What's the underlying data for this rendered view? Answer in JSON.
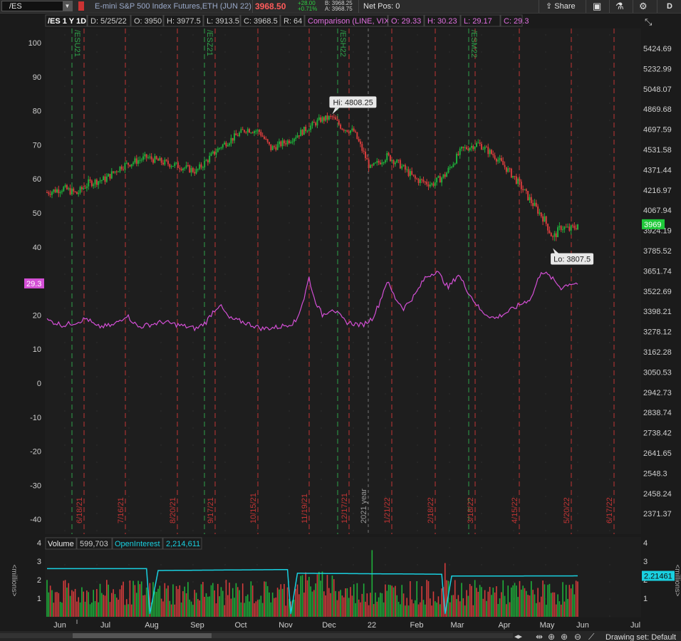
{
  "toolbar": {
    "symbol": "/ES",
    "description": "E-mini S&P 500 Index Futures,ETH (JUN 22)",
    "last": "3968.50",
    "change": "+28.00",
    "change_pct": "+0.71%",
    "bid": "B: 3968.25",
    "ask": "A: 3968.75",
    "net_pos": "Net Pos: 0",
    "share_label": "Share",
    "d_label": "D"
  },
  "header": {
    "title": "/ES 1 Y 1D",
    "date": "D: 5/25/22",
    "open": "O: 3950",
    "high": "H: 3977.5",
    "low": "L: 3913.5",
    "close": "C: 3968.5",
    "range": "R: 64",
    "comparison": "Comparison (LINE, VIX)",
    "c_open": "O: 29.33",
    "c_high": "H: 30.23",
    "c_low": "L: 29.17",
    "c_close": "C: 29.3"
  },
  "colors": {
    "up": "#1fae3a",
    "down": "#d43c3c",
    "vix": "#d44fd6",
    "oi": "#19d0e0",
    "exp_line": "#2fa34a",
    "month_line": "#c23434"
  },
  "chart_data": [
    {
      "type": "candlestick",
      "title": "/ES 1 Y 1D",
      "price_axis": [
        "5424.69",
        "5232.99",
        "5048.07",
        "4869.68",
        "4697.59",
        "4531.58",
        "4371.44",
        "4216.97",
        "4067.94",
        "3924.19",
        "3785.52",
        "3651.74",
        "3522.69",
        "3398.21",
        "3278.12",
        "3162.28",
        "3050.53",
        "2942.73",
        "2838.74",
        "2738.42",
        "2641.65",
        "2548.3",
        "2458.24",
        "2371.37"
      ],
      "left_axis": [
        100,
        90,
        80,
        70,
        60,
        50,
        40,
        30,
        20,
        10,
        0,
        -10,
        -20,
        -30,
        -40
      ],
      "ylim": [
        2290,
        5640
      ],
      "last_price_label": "3969",
      "high_label": "Hi: 4808.25",
      "low_label": "Lo: 3807.5",
      "high_value": 4808.25,
      "low_value": 3807.5,
      "month_labels": [
        "Jun",
        "Jul",
        "Aug",
        "Sep",
        "Oct",
        "Nov",
        "Dec",
        "22",
        "Feb",
        "Mar",
        "Apr",
        "May",
        "Jun",
        "Jul"
      ],
      "expiration_labels": [
        "/ESU21",
        "/ESZ21",
        "/ESH22",
        "/ESM22"
      ],
      "date_labels": [
        "6/18/21",
        "7/16/21",
        "8/20/21",
        "9/17/21",
        "10/15/21",
        "11/19/21",
        "12/17/21",
        "2021 year",
        "1/21/22",
        "2/18/22",
        "3/18/22",
        "4/15/22",
        "5/20/22",
        "6/17/22"
      ],
      "price_keypoints": [
        [
          0,
          4200
        ],
        [
          10,
          4230
        ],
        [
          18,
          4190
        ],
        [
          25,
          4270
        ],
        [
          35,
          4300
        ],
        [
          45,
          4400
        ],
        [
          60,
          4470
        ],
        [
          70,
          4430
        ],
        [
          80,
          4400
        ],
        [
          90,
          4360
        ],
        [
          105,
          4560
        ],
        [
          120,
          4700
        ],
        [
          128,
          4680
        ],
        [
          135,
          4540
        ],
        [
          145,
          4600
        ],
        [
          155,
          4690
        ],
        [
          165,
          4780
        ],
        [
          172,
          4800
        ],
        [
          178,
          4710
        ],
        [
          185,
          4680
        ],
        [
          195,
          4380
        ],
        [
          205,
          4480
        ],
        [
          212,
          4420
        ],
        [
          222,
          4300
        ],
        [
          232,
          4260
        ],
        [
          240,
          4330
        ],
        [
          250,
          4530
        ],
        [
          260,
          4580
        ],
        [
          270,
          4480
        ],
        [
          282,
          4310
        ],
        [
          292,
          4130
        ],
        [
          300,
          4000
        ],
        [
          305,
          3870
        ],
        [
          310,
          3950
        ],
        [
          315,
          3930
        ],
        [
          320,
          3960
        ]
      ],
      "vix_keypoints": [
        [
          0,
          18.5
        ],
        [
          10,
          17
        ],
        [
          18,
          18
        ],
        [
          24,
          19
        ],
        [
          30,
          16.5
        ],
        [
          40,
          17
        ],
        [
          48,
          20
        ],
        [
          55,
          16.5
        ],
        [
          70,
          18
        ],
        [
          80,
          17
        ],
        [
          90,
          16
        ],
        [
          96,
          18
        ],
        [
          100,
          21
        ],
        [
          104,
          23
        ],
        [
          110,
          19
        ],
        [
          118,
          18
        ],
        [
          124,
          17
        ],
        [
          130,
          16
        ],
        [
          140,
          16.5
        ],
        [
          150,
          18
        ],
        [
          155,
          25
        ],
        [
          158,
          31
        ],
        [
          161,
          25
        ],
        [
          166,
          20
        ],
        [
          172,
          22
        ],
        [
          180,
          18
        ],
        [
          190,
          17
        ],
        [
          196,
          19
        ],
        [
          200,
          23
        ],
        [
          205,
          30
        ],
        [
          210,
          25
        ],
        [
          215,
          22
        ],
        [
          222,
          26
        ],
        [
          228,
          31
        ],
        [
          235,
          33
        ],
        [
          242,
          28
        ],
        [
          248,
          32
        ],
        [
          255,
          26
        ],
        [
          262,
          21
        ],
        [
          270,
          19
        ],
        [
          278,
          21
        ],
        [
          285,
          23
        ],
        [
          292,
          25
        ],
        [
          298,
          33
        ],
        [
          304,
          31
        ],
        [
          310,
          28
        ],
        [
          315,
          29.3
        ]
      ]
    },
    {
      "type": "bar",
      "title": "Volume",
      "volume_value": "599,703",
      "oi_label": "OpenInterest",
      "oi_value": "2,214,611",
      "oi_tag": "2.21461",
      "ylabel": "<millions>",
      "axis": [
        1,
        2,
        3,
        4
      ],
      "ylim": [
        0,
        4.2
      ],
      "oi_keypoints": [
        [
          0,
          2.6
        ],
        [
          60,
          2.6
        ],
        [
          62,
          0.15
        ],
        [
          67,
          2.5
        ],
        [
          145,
          2.55
        ],
        [
          147,
          0.15
        ],
        [
          151,
          2.35
        ],
        [
          238,
          2.3
        ],
        [
          240,
          0.15
        ],
        [
          244,
          2.2
        ],
        [
          320,
          2.21
        ]
      ]
    }
  ]
}
